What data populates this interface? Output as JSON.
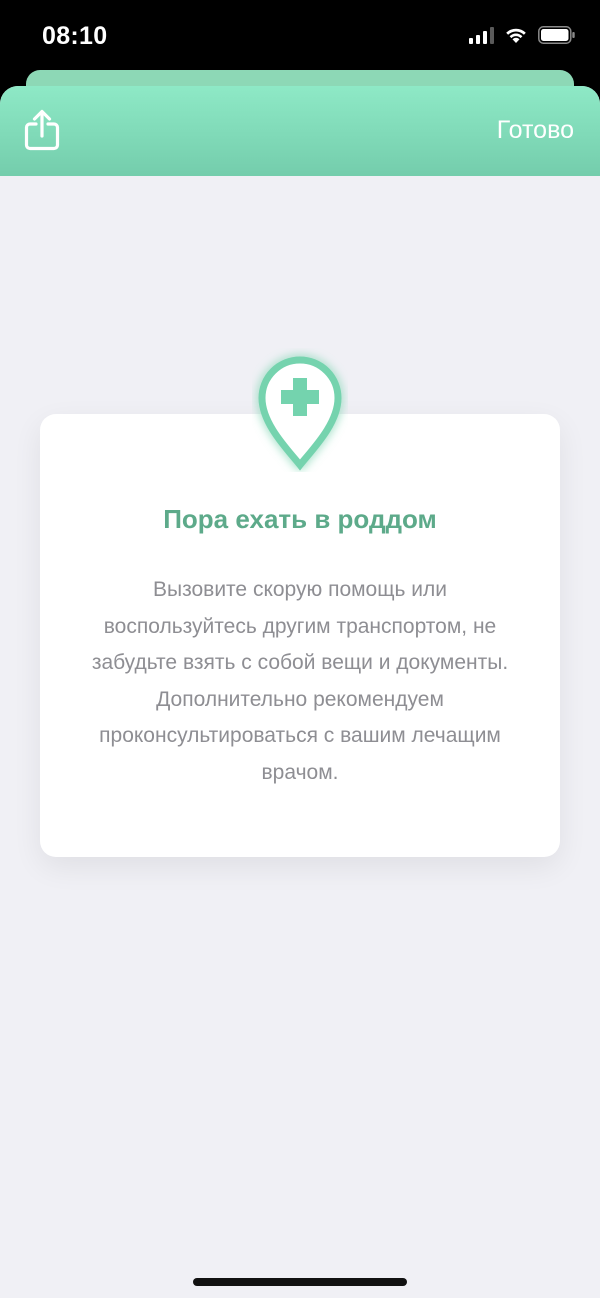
{
  "status_bar": {
    "time": "08:10"
  },
  "header": {
    "share_icon": "share-icon",
    "done_label": "Готово"
  },
  "card": {
    "icon": "medical-location-pin-icon",
    "title": "Пора ехать в роддом",
    "text": "Вызовите скорую помощь или воспользуйтесь другим транспортом, не забудьте взять с собой вещи и документы. Дополнительно рекомендуем проконсультироваться с вашим лечащим врачом."
  },
  "colors": {
    "accent": "#74cdac",
    "title": "#5daa8a",
    "background": "#f0f0f5"
  }
}
